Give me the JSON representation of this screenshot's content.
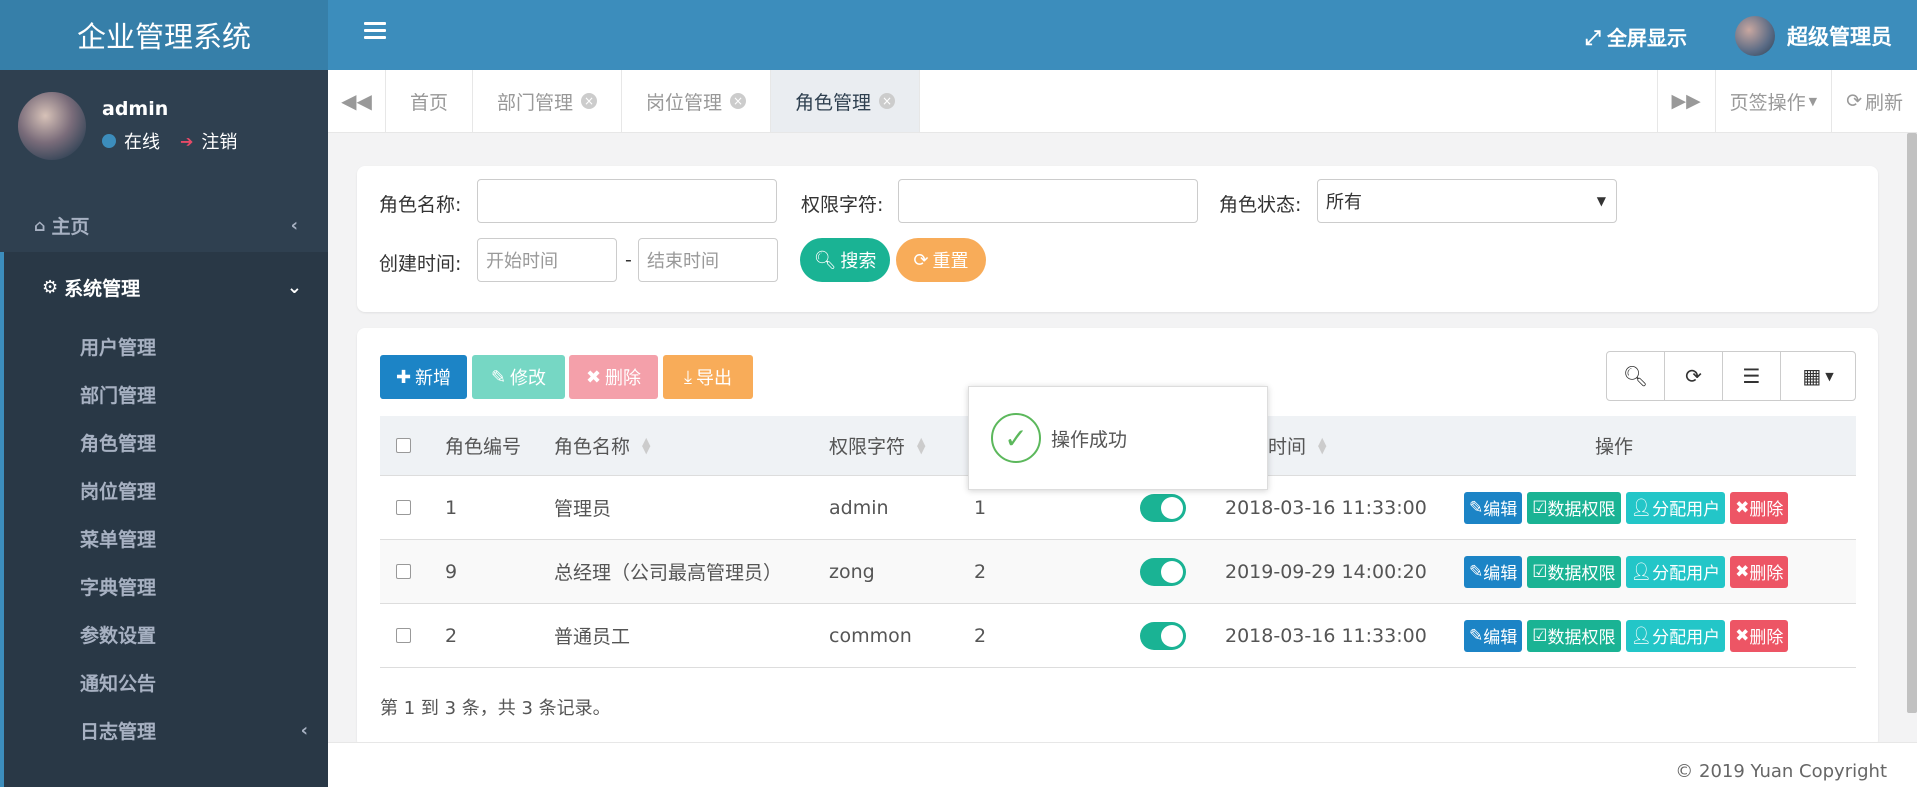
{
  "app": {
    "title": "企业管理系统"
  },
  "topbar": {
    "fullscreen_label": "全屏显示",
    "user_name": "超级管理员"
  },
  "sidebar": {
    "username": "admin",
    "status": "在线",
    "logout": "注销",
    "home": "主页",
    "system": "系统管理",
    "items": [
      "用户管理",
      "部门管理",
      "角色管理",
      "岗位管理",
      "菜单管理",
      "字典管理",
      "参数设置",
      "通知公告",
      "日志管理"
    ]
  },
  "tabs": {
    "items": [
      {
        "label": "首页"
      },
      {
        "label": "部门管理"
      },
      {
        "label": "岗位管理"
      },
      {
        "label": "角色管理"
      }
    ],
    "actions_label": "页签操作",
    "refresh_label": "刷新"
  },
  "search": {
    "role_name_label": "角色名称:",
    "perm_label": "权限字符:",
    "status_label": "角色状态:",
    "status_value": "所有",
    "create_time_label": "创建时间:",
    "start_placeholder": "开始时间",
    "end_placeholder": "结束时间",
    "dash": "-",
    "search_btn": "搜索",
    "reset_btn": "重置"
  },
  "toolbar": {
    "add": "新增",
    "edit": "修改",
    "delete": "删除",
    "export": "导出"
  },
  "table": {
    "headers": {
      "id": "角色编号",
      "name": "角色名称",
      "perm": "权限字符",
      "time": "时间",
      "ops": "操作"
    },
    "rows": [
      {
        "id": "1",
        "name": "管理员",
        "perm": "admin",
        "sort": "1",
        "time": "2018-03-16 11:33:00"
      },
      {
        "id": "9",
        "name": "总经理（公司最高管理员）",
        "perm": "zong",
        "sort": "2",
        "time": "2019-09-29 14:00:20"
      },
      {
        "id": "2",
        "name": "普通员工",
        "perm": "common",
        "sort": "2",
        "time": "2018-03-16 11:33:00"
      }
    ],
    "row_actions": {
      "edit": "编辑",
      "data_perm": "数据权限",
      "assign": "分配用户",
      "delete": "删除"
    },
    "pager": "第 1 到 3 条，共 3 条记录。"
  },
  "toast": {
    "message": "操作成功"
  },
  "footer": {
    "copyright": "© 2019 Yuan Copyright"
  },
  "colors": {
    "primary": "#1c84c6",
    "success": "#1ab394",
    "info": "#23c6c8",
    "warning": "#f8ac59",
    "danger": "#ed5565",
    "sidebar": "#2f4050",
    "topbar": "#3c8dbc"
  }
}
